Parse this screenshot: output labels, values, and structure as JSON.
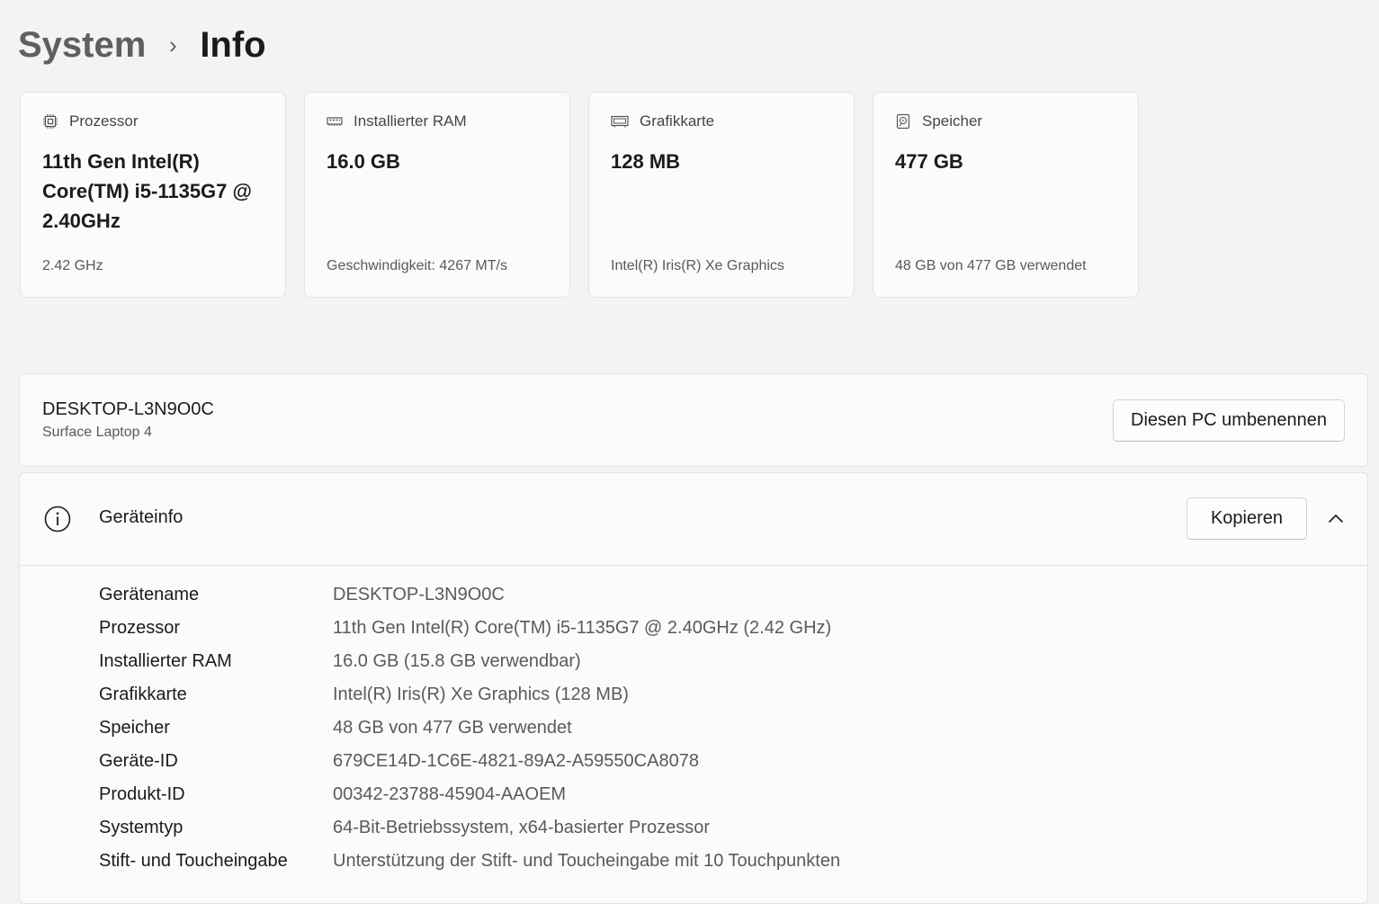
{
  "breadcrumb": {
    "parent": "System",
    "separator": "›",
    "current": "Info"
  },
  "cards": [
    {
      "icon": "processor-chip-icon",
      "label": "Prozessor",
      "value": "11th Gen Intel(R) Core(TM) i5-1135G7 @ 2.40GHz",
      "sub": "2.42 GHz"
    },
    {
      "icon": "ram-module-icon",
      "label": "Installierter RAM",
      "value": "16.0 GB",
      "sub": "Geschwindigkeit: 4267 MT/s"
    },
    {
      "icon": "graphics-card-icon",
      "label": "Grafikkarte",
      "value": "128 MB",
      "sub": "Intel(R) Iris(R) Xe Graphics"
    },
    {
      "icon": "storage-drive-icon",
      "label": "Speicher",
      "value": "477 GB",
      "sub": "48 GB von 477 GB verwendet"
    }
  ],
  "pc": {
    "name": "DESKTOP-L3N9O0C",
    "model": "Surface Laptop 4",
    "rename_label": "Diesen PC umbenennen"
  },
  "device_info": {
    "icon": "info-circle-icon",
    "title": "Geräteinfo",
    "copy_label": "Kopieren",
    "expanded": true,
    "specs": [
      {
        "label": "Gerätename",
        "value": "DESKTOP-L3N9O0C"
      },
      {
        "label": "Prozessor",
        "value": "11th Gen Intel(R) Core(TM) i5-1135G7 @ 2.40GHz (2.42 GHz)"
      },
      {
        "label": "Installierter RAM",
        "value": "16.0 GB (15.8 GB verwendbar)"
      },
      {
        "label": "Grafikkarte",
        "value": "Intel(R) Iris(R) Xe Graphics (128 MB)"
      },
      {
        "label": "Speicher",
        "value": "48 GB von 477 GB verwendet"
      },
      {
        "label": "Geräte-ID",
        "value": "679CE14D-1C6E-4821-89A2-A59550CA8078"
      },
      {
        "label": "Produkt-ID",
        "value": "00342-23788-45904-AAOEM"
      },
      {
        "label": "Systemtyp",
        "value": "64-Bit-Betriebssystem, x64-basierter Prozessor"
      },
      {
        "label": "Stift- und Toucheingabe",
        "value": "Unterstützung der Stift- und Toucheingabe mit 10 Touchpunkten"
      }
    ]
  },
  "colors": {
    "background": "#f3f3f3",
    "panel": "#fbfbfb",
    "border": "#e3e3e3",
    "text_primary": "#1b1b1b",
    "text_secondary": "#5a5a5a"
  }
}
